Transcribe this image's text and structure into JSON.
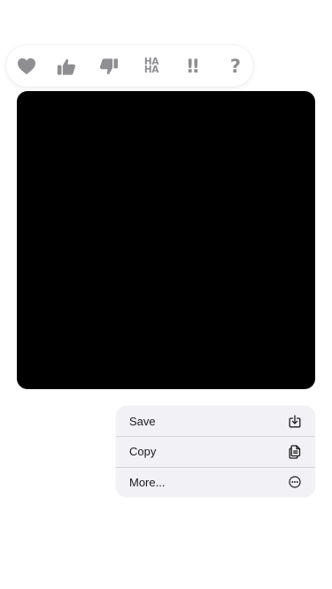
{
  "tapbacks": [
    {
      "name": "heart",
      "icon": "heart-icon"
    },
    {
      "name": "thumbs-up",
      "icon": "thumbs-up-icon"
    },
    {
      "name": "thumbs-down",
      "icon": "thumbs-down-icon"
    },
    {
      "name": "haha",
      "icon": "haha-icon",
      "line1": "HA",
      "line2": "HA"
    },
    {
      "name": "emphasize",
      "icon": "double-exclamation-icon",
      "glyph": "‼"
    },
    {
      "name": "question",
      "icon": "question-mark-icon",
      "glyph": "?"
    }
  ],
  "message": {
    "kind": "image",
    "background": "#000000"
  },
  "context_menu": {
    "items": [
      {
        "label": "Save",
        "icon": "save-download-icon"
      },
      {
        "label": "Copy",
        "icon": "copy-icon"
      },
      {
        "label": "More...",
        "icon": "more-ellipsis-icon"
      }
    ]
  },
  "colors": {
    "tapback_icon": "#8e8e93",
    "menu_background": "#f2f2f6",
    "menu_text": "#1c1c1e"
  }
}
